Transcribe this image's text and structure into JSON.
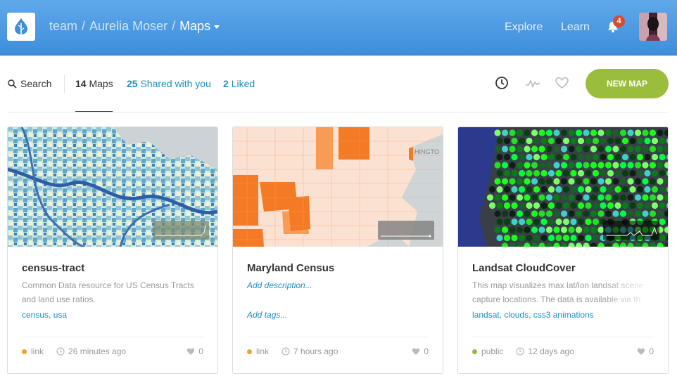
{
  "header": {
    "breadcrumb": [
      "team",
      "Aurelia Moser"
    ],
    "current": "Maps",
    "nav": {
      "explore": "Explore",
      "learn": "Learn"
    },
    "notifications": "4"
  },
  "filters": {
    "search": "Search",
    "tabs": [
      {
        "count": "14",
        "label": "Maps"
      },
      {
        "count": "25",
        "label": "Shared with you"
      },
      {
        "count": "2",
        "label": "Liked"
      }
    ],
    "new_map": "NEW MAP"
  },
  "cards": [
    {
      "title": "census-tract",
      "description": "Common Data resource for US Census Tracts and land use ratios.",
      "tags": [
        "census",
        "usa"
      ],
      "privacy": "link",
      "privacy_color": "#f0a22b",
      "updated": "26 minutes ago",
      "likes": "0"
    },
    {
      "title": "Maryland Census",
      "description": "Add description...",
      "tags": [
        "Add tags..."
      ],
      "privacy": "link",
      "privacy_color": "#f0a22b",
      "updated": "7 hours ago",
      "likes": "0"
    },
    {
      "title": "Landsat CloudCover",
      "description": "This map visualizes max lat/lon landsat scene capture locations. The data is available via th",
      "tags": [
        "landsat",
        "clouds",
        "css3 animations"
      ],
      "privacy": "public",
      "privacy_color": "#8ac03f",
      "updated": "12 days ago",
      "likes": "0"
    }
  ],
  "map_overlay_text": "HINGTO"
}
